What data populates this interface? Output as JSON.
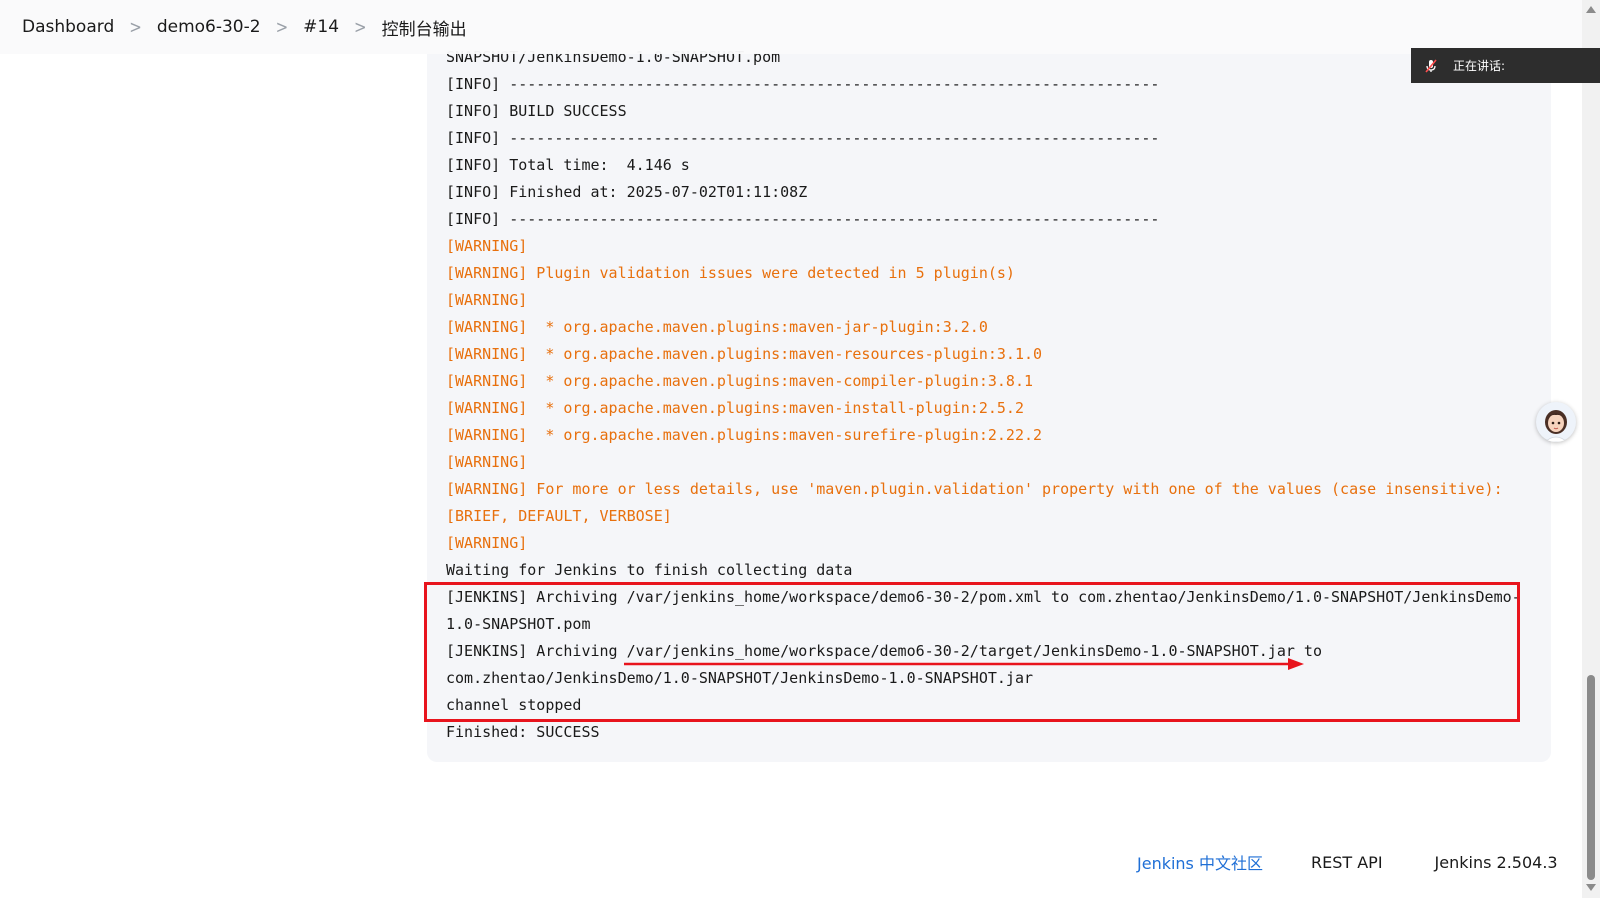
{
  "breadcrumb": {
    "items": [
      "Dashboard",
      "demo6-30-2",
      "#14",
      "控制台输出"
    ]
  },
  "console": {
    "lines": [
      {
        "text": "SNAPSHOT/JenkinsDemo-1.0-SNAPSHOT.pom",
        "level": "info"
      },
      {
        "text": "[INFO] ------------------------------------------------------------------------",
        "level": "info"
      },
      {
        "text": "[INFO] BUILD SUCCESS",
        "level": "info"
      },
      {
        "text": "[INFO] ------------------------------------------------------------------------",
        "level": "info"
      },
      {
        "text": "[INFO] Total time:  4.146 s",
        "level": "info"
      },
      {
        "text": "[INFO] Finished at: 2025-07-02T01:11:08Z",
        "level": "info"
      },
      {
        "text": "[INFO] ------------------------------------------------------------------------",
        "level": "info"
      },
      {
        "text": "[WARNING]",
        "level": "warning"
      },
      {
        "text": "[WARNING] Plugin validation issues were detected in 5 plugin(s)",
        "level": "warning"
      },
      {
        "text": "[WARNING]",
        "level": "warning"
      },
      {
        "text": "[WARNING]  * org.apache.maven.plugins:maven-jar-plugin:3.2.0",
        "level": "warning"
      },
      {
        "text": "[WARNING]  * org.apache.maven.plugins:maven-resources-plugin:3.1.0",
        "level": "warning"
      },
      {
        "text": "[WARNING]  * org.apache.maven.plugins:maven-compiler-plugin:3.8.1",
        "level": "warning"
      },
      {
        "text": "[WARNING]  * org.apache.maven.plugins:maven-install-plugin:2.5.2",
        "level": "warning"
      },
      {
        "text": "[WARNING]  * org.apache.maven.plugins:maven-surefire-plugin:2.22.2",
        "level": "warning"
      },
      {
        "text": "[WARNING]",
        "level": "warning"
      },
      {
        "text": "[WARNING] For more or less details, use 'maven.plugin.validation' property with one of the values (case insensitive):",
        "level": "warning"
      },
      {
        "text": "[BRIEF, DEFAULT, VERBOSE]",
        "level": "warning"
      },
      {
        "text": "[WARNING]",
        "level": "warning"
      },
      {
        "text": "Waiting for Jenkins to finish collecting data",
        "level": "info"
      },
      {
        "text": "[JENKINS] Archiving /var/jenkins_home/workspace/demo6-30-2/pom.xml to com.zhentao/JenkinsDemo/1.0-SNAPSHOT/JenkinsDemo-",
        "level": "info"
      },
      {
        "text": "1.0-SNAPSHOT.pom",
        "level": "info"
      },
      {
        "text": "[JENKINS] Archiving /var/jenkins_home/workspace/demo6-30-2/target/JenkinsDemo-1.0-SNAPSHOT.jar to",
        "level": "info"
      },
      {
        "text": "com.zhentao/JenkinsDemo/1.0-SNAPSHOT/JenkinsDemo-1.0-SNAPSHOT.jar",
        "level": "info"
      },
      {
        "text": "channel stopped",
        "level": "info"
      },
      {
        "text": "Finished: SUCCESS",
        "level": "info"
      }
    ],
    "warning_color": "#e8700d",
    "annotation_color": "#e8141d"
  },
  "speaking_indicator": {
    "label": "正在讲话:",
    "icon": "muted-mic-icon"
  },
  "footer": {
    "community_link": "Jenkins 中文社区",
    "rest_api": "REST API",
    "version": "Jenkins 2.504.3"
  },
  "accent_color": "#1f6fd6"
}
